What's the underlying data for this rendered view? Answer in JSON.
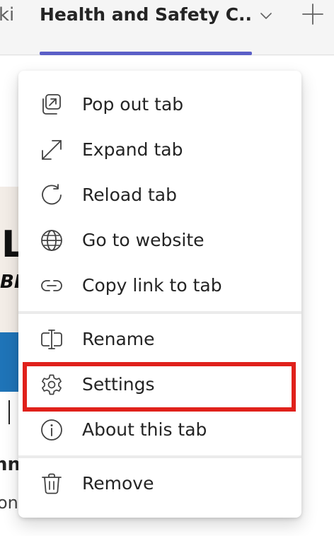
{
  "tabbar": {
    "prev_tab_label": "ki",
    "active_tab_label": "Health and Safety C...",
    "accent_color": "#5b5fc7",
    "dropdown_icon": "chevron-down-icon",
    "add_icon": "plus-icon"
  },
  "background": {
    "card_text_1": "L",
    "card_text_2": "BE",
    "text_1": "nn",
    "text_2": "on"
  },
  "menu": {
    "group1": [
      {
        "label": "Pop out tab",
        "icon": "pop-out-icon"
      },
      {
        "label": "Expand tab",
        "icon": "expand-icon"
      },
      {
        "label": "Reload tab",
        "icon": "reload-icon"
      },
      {
        "label": "Go to website",
        "icon": "globe-icon"
      },
      {
        "label": "Copy link to tab",
        "icon": "link-icon"
      }
    ],
    "group2": [
      {
        "label": "Rename",
        "icon": "rename-icon"
      },
      {
        "label": "Settings",
        "icon": "gear-icon"
      },
      {
        "label": "About this tab",
        "icon": "info-icon"
      }
    ],
    "group3": [
      {
        "label": "Remove",
        "icon": "trash-icon"
      }
    ],
    "highlight_color": "#e0211b"
  }
}
